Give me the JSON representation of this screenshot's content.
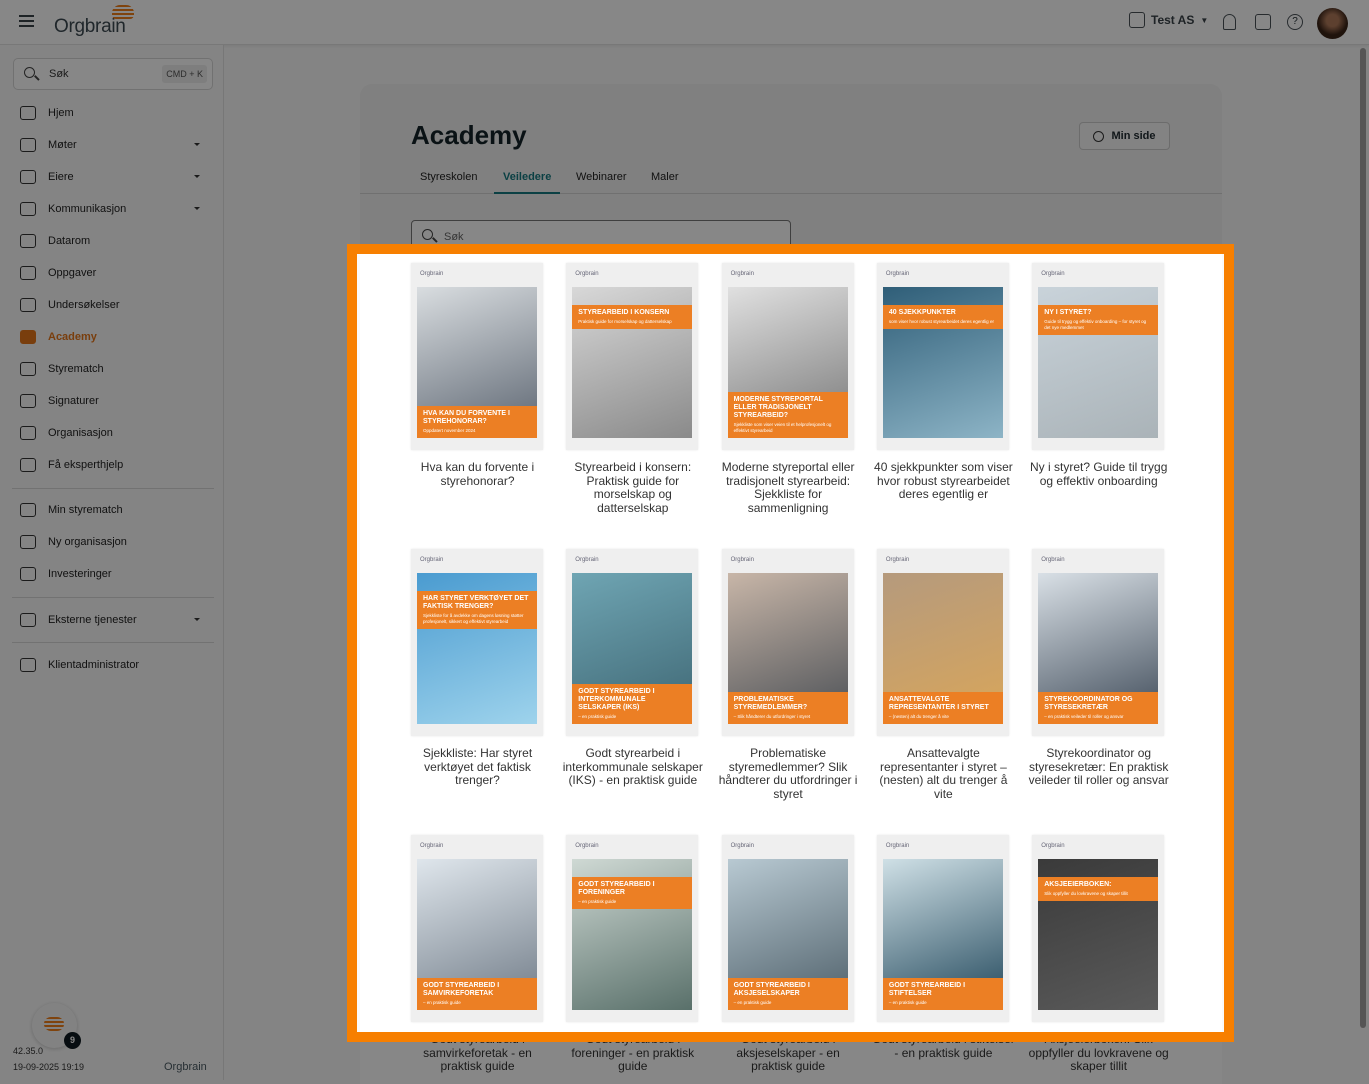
{
  "header": {
    "app": "Orgbrain",
    "company": "Test AS"
  },
  "sidebar": {
    "search_label": "Søk",
    "search_shortcut": "CMD + K",
    "items": [
      "Hjem",
      "Møter",
      "Eiere",
      "Kommunikasjon",
      "Datarom",
      "Oppgaver",
      "Undersøkelser",
      "Academy",
      "Styrematch",
      "Signaturer",
      "Organisasjon",
      "Få eksperthjelp"
    ],
    "items2": [
      "Min styrematch",
      "Ny organisasjon",
      "Investeringer"
    ],
    "external": "Eksterne tjenester",
    "admin": "Klientadministrator",
    "version": "42.35.0",
    "date": "19-09-2025 19:19",
    "badge": "9",
    "footer_logo": "Orgbrain"
  },
  "main": {
    "title": "Academy",
    "my_page": "Min side",
    "tabs": [
      "Styreskolen",
      "Veiledere",
      "Webinarer",
      "Maler"
    ],
    "search_placeholder": "Søk"
  },
  "books": [
    {
      "title": "Hva kan du forvente i styrehonorar?",
      "cover_title": "Hva kan du forvente i STYREHONORAR?",
      "cover_sub": "Oppdatert november 2024",
      "band": "bottom",
      "img": [
        "#d9dde0",
        "#5b6470"
      ]
    },
    {
      "title": "Styrearbeid i konsern: Praktisk guide for morselskap og datterselskap",
      "cover_title": "Styrearbeid i konsern",
      "cover_sub": "Praktisk guide for morselskap og datterselskap",
      "band": "top",
      "img": [
        "#d8d8d8",
        "#8a8a8a"
      ]
    },
    {
      "title": "Moderne styreportal eller tradisjonelt styrearbeid: Sjekkliste for sammenligning",
      "cover_title": "Moderne styreportal eller tradisjonelt styrearbeid?",
      "cover_sub": "Sjekkliste som viser veien til et helprofesjonelt og effektivt styrearbeid",
      "band": "bottom",
      "img": [
        "#e0e0e0",
        "#777"
      ]
    },
    {
      "title": "40 sjekkpunkter som viser hvor robust styrearbeidet deres egentlig er",
      "cover_title": "40 sjekkpunkter",
      "cover_sub": "som viser hvor robust styrearbeidet deres egentlig er",
      "band": "top",
      "img": [
        "#2f5e78",
        "#8db4c6"
      ]
    },
    {
      "title": "Ny i styret? Guide til trygg og effektiv onboarding",
      "cover_title": "Ny i styret?",
      "cover_sub": "Guide til trygg og effektiv onboarding – for styret og det nye medlemmet",
      "band": "top",
      "img": [
        "#c9d3da",
        "#aab3b8"
      ]
    },
    {
      "title": "Sjekkliste: Har styret verktøyet det faktisk trenger?",
      "cover_title": "Har styret verktøyet det faktisk trenger?",
      "cover_sub": "Sjekkliste for å avdekke om dagens løsning støtter profesjonelt, sikkert og effektivt styrearbeid",
      "band": "top",
      "img": [
        "#4a9bd0",
        "#9ed3ec"
      ]
    },
    {
      "title": "Godt styrearbeid i interkommunale selskaper (IKS) - en praktisk guide",
      "cover_title": "Godt styrearbeid i interkommunale selskaper (IKS)",
      "cover_sub": "– en praktisk guide",
      "band": "bottom",
      "img": [
        "#6fa5b3",
        "#3e6673"
      ]
    },
    {
      "title": "Problematiske styremedlemmer? Slik håndterer du utfordringer i styret",
      "cover_title": "Problematiske styremedlemmer?",
      "cover_sub": "– Slik håndterer du utfordringer i styret",
      "band": "bottom",
      "img": [
        "#c8b6a8",
        "#4a4f55"
      ]
    },
    {
      "title": "Ansattevalgte representanter i styret – (nesten) alt du trenger å vite",
      "cover_title": "Ansattevalgte representanter i styret",
      "cover_sub": "– (nesten) alt du trenger å vite",
      "band": "bottom",
      "img": [
        "#b59a7d",
        "#d9a65a"
      ]
    },
    {
      "title": "Styrekoordinator og styresekretær: En praktisk veileder til roller og ansvar",
      "cover_title": "Styrekoordinator og styresekretær",
      "cover_sub": "– en praktisk veileder til roller og ansvar",
      "band": "bottom",
      "img": [
        "#d9e0e6",
        "#3e4a58"
      ]
    },
    {
      "title": "Godt styrearbeid i samvirkeforetak - en praktisk guide",
      "cover_title": "Godt styrearbeid i samvirkeforetak",
      "cover_sub": "– en praktisk guide",
      "band": "bottom",
      "img": [
        "#dfe6ec",
        "#6f7a86"
      ]
    },
    {
      "title": "Godt styrearbeid i foreninger - en praktisk guide",
      "cover_title": "Godt styrearbeid i foreninger",
      "cover_sub": "– en praktisk guide",
      "band": "top",
      "img": [
        "#cfd9d4",
        "#59706a"
      ]
    },
    {
      "title": "Godt styrearbeid i aksjeselskaper - en praktisk guide",
      "cover_title": "Godt styrearbeid i aksjeselskaper",
      "cover_sub": "– en praktisk guide",
      "band": "bottom",
      "img": [
        "#b8c9d2",
        "#4d5e68"
      ]
    },
    {
      "title": "Godt styrearbeid i stiftelser - en praktisk guide",
      "cover_title": "Godt styrearbeid i stiftelser",
      "cover_sub": "– en praktisk guide",
      "band": "bottom",
      "img": [
        "#cfe0e6",
        "#20465a"
      ]
    },
    {
      "title": "Aksjeeierboken: Slik oppfyller du lovkravene og skaper tillit",
      "cover_title": "Aksjeeierboken:",
      "cover_sub": "Slik oppfyller du lovkravene og skaper tillit",
      "band": "top",
      "img": [
        "#3a3a3a",
        "#5a5a5a"
      ]
    }
  ],
  "colors": {
    "accent": "#ec7f24",
    "highlight": "#f77f00",
    "tab_active": "#157a80"
  }
}
